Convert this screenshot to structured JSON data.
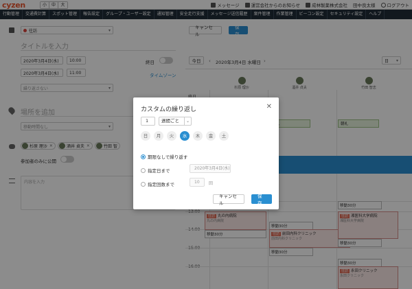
{
  "header": {
    "logo": "cyzen",
    "font_sizes": [
      "小",
      "中",
      "大"
    ],
    "links": [
      {
        "icon": "message-icon",
        "label": "メッセージ"
      },
      {
        "icon": "bell-icon",
        "label": "運営会社からのお知らせ"
      },
      {
        "icon": "building-icon",
        "label": "成林製薬株式会社"
      },
      {
        "icon": "user-icon",
        "label": "田中良太様"
      },
      {
        "icon": "power-icon",
        "label": "ログアウト"
      }
    ]
  },
  "nav": {
    "items": [
      "行動管理",
      "交通費計算",
      "スポット管理",
      "報告設定",
      "グループ・ユーザー設定",
      "通知管理",
      "安全走行支援",
      "メッセージ送信履歴",
      "案件管理",
      "作業管理",
      "ビーコン設定",
      "セキュリティ設定",
      "ヘルプ"
    ]
  },
  "form": {
    "category": "往訪",
    "title_placeholder": "タイトルを入力",
    "start_date": "2020年3月4日(水)",
    "start_time": "10:00",
    "end_date": "2020年3月4日(水)",
    "end_time": "11:00",
    "allday_label": "終日",
    "timezone_link": "タイムゾーン",
    "repeat_select": "繰り返さない",
    "place_placeholder": "場所を追加",
    "move_select": "移動時間なし",
    "participants": [
      "杉原 理沙",
      "酒井 貞夫",
      "竹田 智"
    ],
    "participants_only_label": "参加者のみに公開",
    "content_placeholder": "内容を入力"
  },
  "calendar": {
    "cancel_label": "キャンセル",
    "save_label": "保存",
    "today_label": "今日",
    "date_label": "2020年3月4日 水曜日",
    "view_label": "日",
    "columns": [
      "杉原 理沙",
      "酒井 貞夫",
      "竹田 智志"
    ],
    "allday_label": "終日",
    "morning_label": "朝礼",
    "hours": [
      "13:00",
      "14:00",
      "15:00",
      "16:00"
    ],
    "events": [
      {
        "tag": "往訪",
        "title": "丸の内病院",
        "sub": "丸の内病院"
      },
      {
        "tag": "往訪",
        "title": "前田内科クリニック",
        "sub": "前田内科クリニック"
      },
      {
        "tag": "往訪",
        "title": "湘医科大学病院",
        "sub": "湘医科大学病院"
      },
      {
        "tag": "往訪",
        "title": "永田クリニック",
        "sub": "永田クリニック"
      }
    ],
    "move_label": "移動30分"
  },
  "dialog": {
    "title": "カスタムの繰り返し",
    "interval": "1",
    "unit": "週間ごと",
    "days": [
      "日",
      "月",
      "火",
      "水",
      "木",
      "金",
      "土"
    ],
    "selected_day": "水",
    "options": {
      "no_end": "期限なしで繰り返す",
      "until_date": "指定日まで",
      "until_date_value": "2020年3月4日(水)",
      "count": "指定回数まで",
      "count_value": "10",
      "count_unit": "回"
    },
    "cancel_label": "キャンセル",
    "save_label": "保存"
  }
}
